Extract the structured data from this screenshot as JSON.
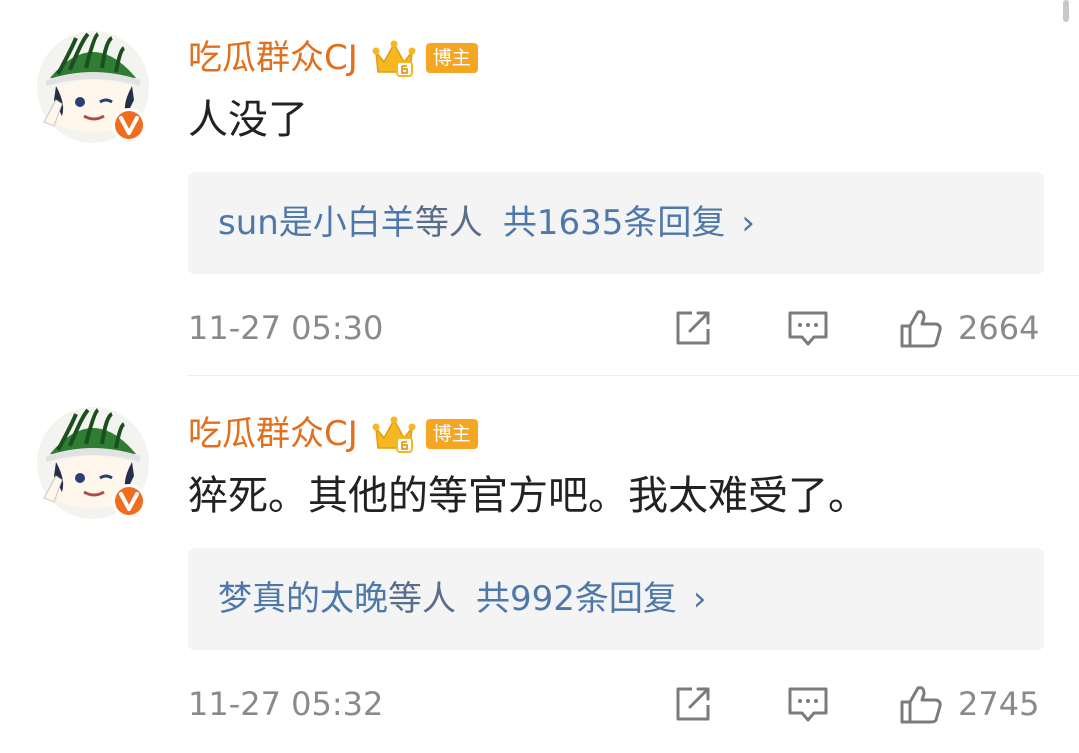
{
  "comments": [
    {
      "username": "吃瓜群众CJ",
      "role_badge": "博主",
      "text": "人没了",
      "reply_names": "sun是小白羊",
      "reply_suffix": "等人",
      "reply_count_text": "共1635条回复",
      "reply_chevron": "›",
      "timestamp": "11-27 05:30",
      "like_count": "2664"
    },
    {
      "username": "吃瓜群众CJ",
      "role_badge": "博主",
      "text": "猝死。其他的等官方吧。我太难受了。",
      "reply_names": "梦真的太晚",
      "reply_suffix": "等人",
      "reply_count_text": "共992条回复",
      "reply_chevron": "›",
      "timestamp": "11-27 05:32",
      "like_count": "2745"
    }
  ],
  "icons": {
    "avatar": "avatar-image",
    "verified": "verified-v-icon",
    "crown": "crown-level-icon",
    "share": "share-icon",
    "comment": "comment-icon",
    "like": "thumbs-up-icon"
  },
  "colors": {
    "username": "#e26f1b",
    "badge": "#f5a623",
    "reply_link": "#4f78aa",
    "meta": "#8a8a8a",
    "reply_bg": "#f4f4f4"
  }
}
